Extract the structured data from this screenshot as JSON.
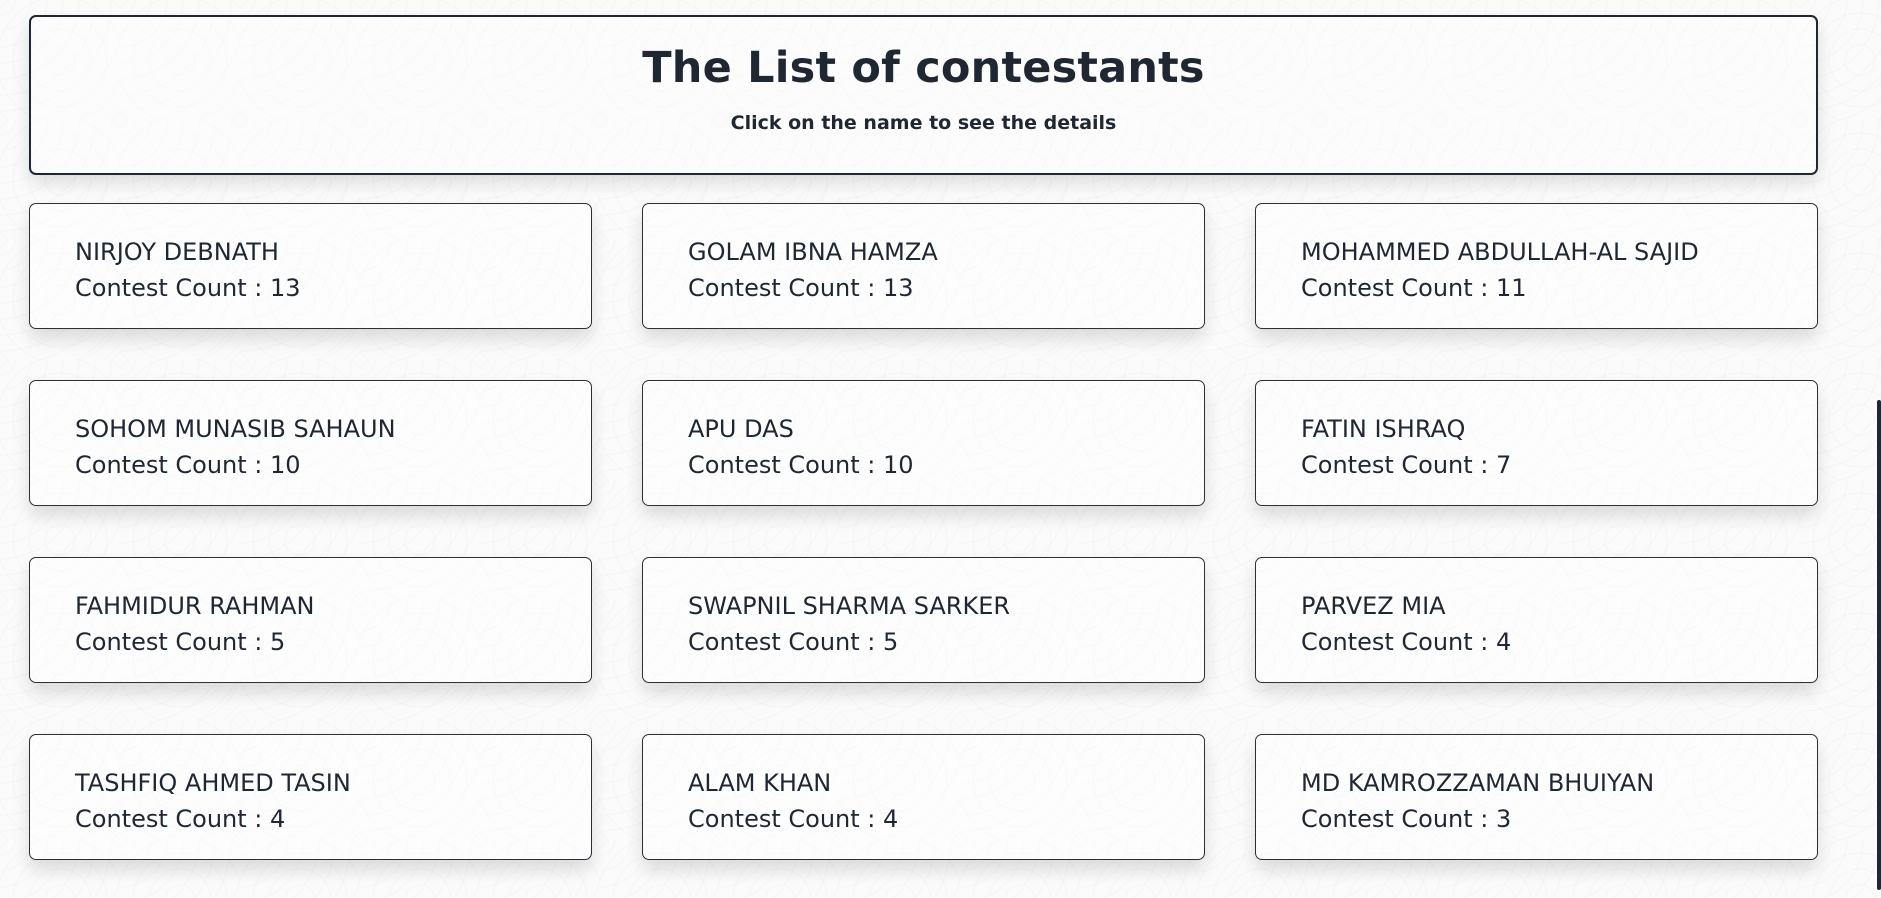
{
  "header": {
    "title": "The List of contestants",
    "subtitle": "Click on the name to see the details"
  },
  "count_label": "Contest Count : ",
  "contestants": [
    {
      "name": "NIRJOY DEBNATH",
      "count": "13"
    },
    {
      "name": "GOLAM IBNA HAMZA",
      "count": "13"
    },
    {
      "name": "MOHAMMED ABDULLAH-AL SAJID",
      "count": "11"
    },
    {
      "name": "SOHOM MUNASIB SAHAUN",
      "count": "10"
    },
    {
      "name": "APU DAS",
      "count": "10"
    },
    {
      "name": "FATIN ISHRAQ",
      "count": "7"
    },
    {
      "name": "FAHMIDUR RAHMAN",
      "count": "5"
    },
    {
      "name": "SWAPNIL SHARMA SARKER",
      "count": "5"
    },
    {
      "name": "PARVEZ MIA",
      "count": "4"
    },
    {
      "name": "TASHFIQ AHMED TASIN",
      "count": "4"
    },
    {
      "name": "ALAM KHAN",
      "count": "4"
    },
    {
      "name": "MD KAMROZZAMAN BHUIYAN",
      "count": "3"
    }
  ]
}
